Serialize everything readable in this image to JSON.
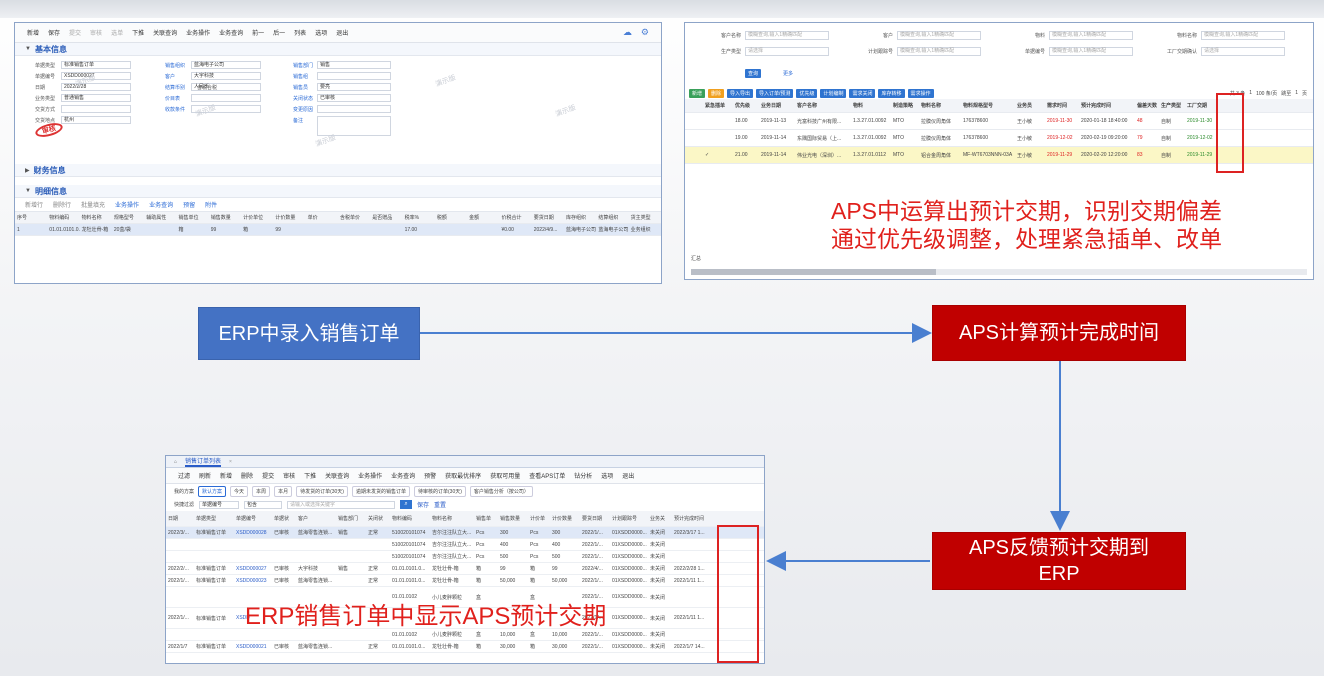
{
  "erp_form": {
    "toolbar": [
      "新增",
      "保存",
      "提交",
      "审核",
      "选单",
      "下推",
      "关联查询",
      "业务操作",
      "业务查询",
      "前一",
      "后一",
      "列表",
      "选项",
      "退出"
    ],
    "sections": {
      "basic": "基本信息",
      "finance": "财务信息",
      "detail": "明细信息"
    },
    "fields": [
      {
        "label": "单据类型",
        "value": "标准销售订单"
      },
      {
        "label": "单据编号",
        "value": "XSDD000027"
      },
      {
        "label": "日期",
        "value": "2022/2/28"
      },
      {
        "label": "业务类型",
        "value": "普通销售"
      },
      {
        "label": "交货方式",
        "value": ""
      },
      {
        "label": "交货地点",
        "value": "杭州"
      },
      {
        "label": "销售组织",
        "value": "蓝海电子公司"
      },
      {
        "label": "客户",
        "value": "大宇科技"
      },
      {
        "label": "结算币别",
        "value": "人民币"
      },
      {
        "label": "价目表",
        "value": ""
      },
      {
        "label": "收款条件",
        "value": ""
      },
      {
        "label": "销售部门",
        "value": "销售"
      },
      {
        "label": "销售组",
        "value": ""
      },
      {
        "label": "销售员",
        "value": "要亮"
      },
      {
        "label": "关闭状态",
        "value": "已审核"
      },
      {
        "label": "变更原因",
        "value": ""
      },
      {
        "label": "备注",
        "value": ""
      }
    ],
    "tax_checkbox": "含税合税",
    "stamp": "审核",
    "watermark": "演示版",
    "grid_toolbar": [
      "新增行",
      "删除行",
      "批量填充",
      "业务操作",
      "业务查询",
      "预留",
      "附件"
    ],
    "grid_headers": [
      "序号",
      "物料编码",
      "物料名称",
      "规格型号",
      "辅助属性",
      "销售单位",
      "销售数量",
      "计价单位",
      "计价数量",
      "单价",
      "含税单价",
      "是否赠品",
      "税率%",
      "税额",
      "金额",
      "价税合计",
      "要货日期",
      "库存组织",
      "结算组织",
      "货主类型"
    ],
    "grid_row": [
      "1",
      "01.01.0101.0...",
      "龙牡壮骨-箱",
      "20盒/袋",
      "",
      "箱",
      "99",
      "箱",
      "99",
      "",
      "",
      "",
      "17.00",
      "",
      "",
      "¥0.00",
      "2022/4/9...",
      "蓝海电子公司",
      "蓝海电子公司",
      "业务组织"
    ]
  },
  "aps": {
    "filters": [
      {
        "label": "客户名称",
        "placeholder": "模糊查询,输入1精确匹配"
      },
      {
        "label": "客户",
        "placeholder": "模糊查询,输入1精确匹配"
      },
      {
        "label": "物料",
        "placeholder": "模糊查询,输入1精确匹配"
      },
      {
        "label": "物料名称",
        "placeholder": "模糊查询,输入1精确匹配"
      },
      {
        "label": "生产类型",
        "placeholder": "请选择"
      },
      {
        "label": "计划跟踪号",
        "placeholder": "模糊查询,输入1精确匹配"
      },
      {
        "label": "单据编号",
        "placeholder": "模糊查询,输入1精确匹配"
      },
      {
        "label": "工厂交期确认",
        "placeholder": "请选择"
      }
    ],
    "query_btn": "查询",
    "more_btn": "更多",
    "buttons": [
      "新增",
      "删除",
      "导入导出",
      "导入订单/预测",
      "优先级",
      "计划编制",
      "需求关闭",
      "库存转移",
      "需求操作"
    ],
    "pager": {
      "total": "共 3 条",
      "page": "1",
      "size": "100 条/页",
      "jump": "跳至",
      "jump_page": "1",
      "unit": "页"
    },
    "headers": [
      "",
      "紧急插单",
      "优先级",
      "业务日期",
      "客户名称",
      "物料",
      "制造策略",
      "物料名称",
      "物料规格型号",
      "业务员",
      "需求时间",
      "预计完成时间",
      "偏差天数",
      "生产类型",
      "工厂交期"
    ],
    "rows": [
      [
        "",
        "",
        "18.00",
        "2019-11-13",
        "光富科技广州有限...",
        "1.3.27.01.0092",
        "MTO",
        "拉膜仪周角体",
        "176378600",
        "王小敏",
        "2019-11-30",
        "2020-01-18 18:40:00",
        "48",
        "自制",
        "2019-11-30"
      ],
      [
        "",
        "",
        "19.00",
        "2019-11-14",
        "东隅国际贸易（上...",
        "1.3.27.01.0092",
        "MTO",
        "拉膜仪周角体",
        "176378600",
        "王小敏",
        "2019-12-02",
        "2020-02-19 09:20:00",
        "79",
        "自制",
        "2019-12-02"
      ],
      [
        "",
        "✓",
        "21.00",
        "2019-11-14",
        "伟业光电（深圳）...",
        "1.3.27.01.0112",
        "MTO",
        "铝合金周角体",
        "MF-WT6703NNN-03A",
        "王小敏",
        "2019-11-29",
        "2020-02-20 12:20:00",
        "83",
        "自制",
        "2019-11-29"
      ]
    ],
    "footer": "汇总"
  },
  "callouts": {
    "aps_line1": "APS中运算出预计交期，识别交期偏差",
    "aps_line2": "通过优先级调整，处理紧急插单、改单",
    "erp_caption": "ERP销售订单中显示APS预计交期"
  },
  "flow": {
    "erp_entry": "ERP中录入销售订单",
    "aps_calc": "APS计算预计完成时间",
    "aps_feedback_line1": "APS反馈预计交期到",
    "aps_feedback_line2": "ERP"
  },
  "erp_list": {
    "tab": "销售订单列表",
    "toolbar": [
      "过滤",
      "刷新",
      "新增",
      "删除",
      "提交",
      "审核",
      "下推",
      "关联查询",
      "业务操作",
      "业务查询",
      "预警",
      "获取最优排序",
      "获取可用量",
      "查看APS订单",
      "钻分析",
      "选项",
      "退出"
    ],
    "schemes_label": "我的方案",
    "schemes": [
      "默认方案",
      "今天",
      "本周",
      "本月",
      "待发货的订单(30天)",
      "逾期未发货的销售订单",
      "待审核的订单(30天)",
      "客户销售分析（按公司）"
    ],
    "quick_filter_label": "快捷过滤",
    "quick_filter_field": "单据编号",
    "quick_filter_op": "包含",
    "quick_filter_placeholder": "请输入或选择关键字",
    "save": "保存",
    "reset": "重置",
    "headers": [
      "日期",
      "单据类型",
      "单据编号",
      "单据状",
      "客户",
      "销售部门",
      "关闭状",
      "物料编码",
      "物料名称",
      "销售单",
      "销售数量",
      "计价单",
      "计价数量",
      "要货日期",
      "计划跟踪号",
      "业务关",
      "预计完成时间"
    ],
    "rows": [
      [
        "2022/3/...",
        "标准销售订单",
        "XSDD000028",
        "已审核",
        "蓝海零售连锁...",
        "销售",
        "正常",
        "510020101074",
        "吉尔注注队立大...",
        "Pcs",
        "300",
        "Pcs",
        "300",
        "2022/1/...",
        "01XSDD0000...",
        "未关闭",
        "2022/3/17 1..."
      ],
      [
        "",
        "",
        "",
        "",
        "",
        "",
        "",
        "510020101074",
        "吉尔注注队立大...",
        "Pcs",
        "400",
        "Pcs",
        "400",
        "2022/1/...",
        "01XSDD0000...",
        "未关闭",
        ""
      ],
      [
        "",
        "",
        "",
        "",
        "",
        "",
        "",
        "510020101074",
        "吉尔注注队立大...",
        "Pcs",
        "500",
        "Pcs",
        "500",
        "2022/1/...",
        "01XSDD0000...",
        "未关闭",
        ""
      ],
      [
        "2022/2/...",
        "标准销售订单",
        "XSDD000027",
        "已审核",
        "大宇科技",
        "销售",
        "正常",
        "01.01.0101.0...",
        "龙牡壮骨-箱",
        "箱",
        "99",
        "箱",
        "99",
        "2022/4/...",
        "01XSDD0000...",
        "未关闭",
        "2022/2/28 1..."
      ],
      [
        "2022/1/...",
        "标准销售订单",
        "XSDD000023",
        "已审核",
        "蓝海零售连锁...",
        "",
        "正常",
        "01.01.0101.0...",
        "龙牡壮骨-箱",
        "箱",
        "50,000",
        "箱",
        "50,000",
        "2022/1/...",
        "01XSDD0000...",
        "未关闭",
        "2022/1/11 1..."
      ],
      [
        "",
        "",
        "",
        "",
        "",
        "",
        "",
        "01.01.0102",
        "小儿麦胖颗粒",
        "盒",
        "",
        "盒",
        "",
        "2022/1/...",
        "01XSDD0000...",
        "未关闭",
        ""
      ],
      [
        "2022/1/...",
        "标准销售订单",
        "XSDD",
        "",
        "",
        "",
        "",
        "",
        "",
        "",
        "",
        "",
        "",
        "2022/1/...",
        "01XSDD0000...",
        "未关闭",
        "2022/1/11 1..."
      ],
      [
        "",
        "",
        "",
        "",
        "",
        "",
        "",
        "01.01.0102",
        "小儿麦胖颗粒",
        "盒",
        "10,000",
        "盒",
        "10,000",
        "2022/1/...",
        "01XSDD0000...",
        "未关闭",
        ""
      ],
      [
        "2022/1/7",
        "标准销售订单",
        "XSDD000021",
        "已审核",
        "蓝海零售连锁...",
        "",
        "正常",
        "01.01.0101.0...",
        "龙牡壮骨-箱",
        "箱",
        "30,000",
        "箱",
        "30,000",
        "2022/1/...",
        "01XSDD0000...",
        "未关闭",
        "2022/1/7 14..."
      ]
    ]
  },
  "colors": {
    "flow_blue": "#4472c4",
    "flow_red": "#c00000",
    "callout_red": "#e0201c",
    "arrow": "#4a7fd0"
  }
}
